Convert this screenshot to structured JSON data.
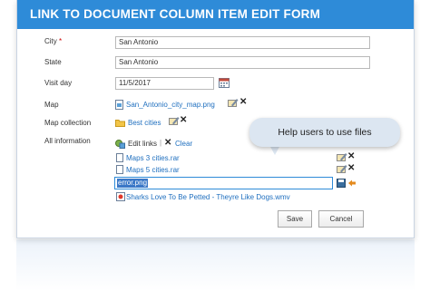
{
  "header": {
    "title": "LINK TO DOCUMENT COLUMN ITEM EDIT FORM"
  },
  "colors": {
    "header": "#2e8bd8",
    "link": "#1f6fbf",
    "tooltip": "#dce6f1"
  },
  "fields": {
    "city": {
      "label": "City",
      "required_mark": "*",
      "value": "San Antonio"
    },
    "state": {
      "label": "State",
      "value": "San Antonio"
    },
    "visit_day": {
      "label": "Visit day",
      "value": "11/5/2017",
      "icon": "calendar-icon"
    },
    "map": {
      "label": "Map",
      "file": "San_Antonio_city_map.png"
    },
    "map_collection": {
      "label": "Map collection",
      "folder": "Best cities"
    },
    "all_information": {
      "label": "All information",
      "edit_links": "Edit links",
      "clear": "Clear",
      "items": [
        {
          "name": "Maps 3 cities.rar"
        },
        {
          "name": "Maps 5 cities.rar"
        },
        {
          "name": "error.png",
          "editing": true
        },
        {
          "name": "Sharks Love To Be Petted - Theyre Like Dogs.wmv"
        }
      ]
    }
  },
  "tooltip": {
    "text": "Help users to use files"
  },
  "buttons": {
    "save": "Save",
    "cancel": "Cancel"
  }
}
